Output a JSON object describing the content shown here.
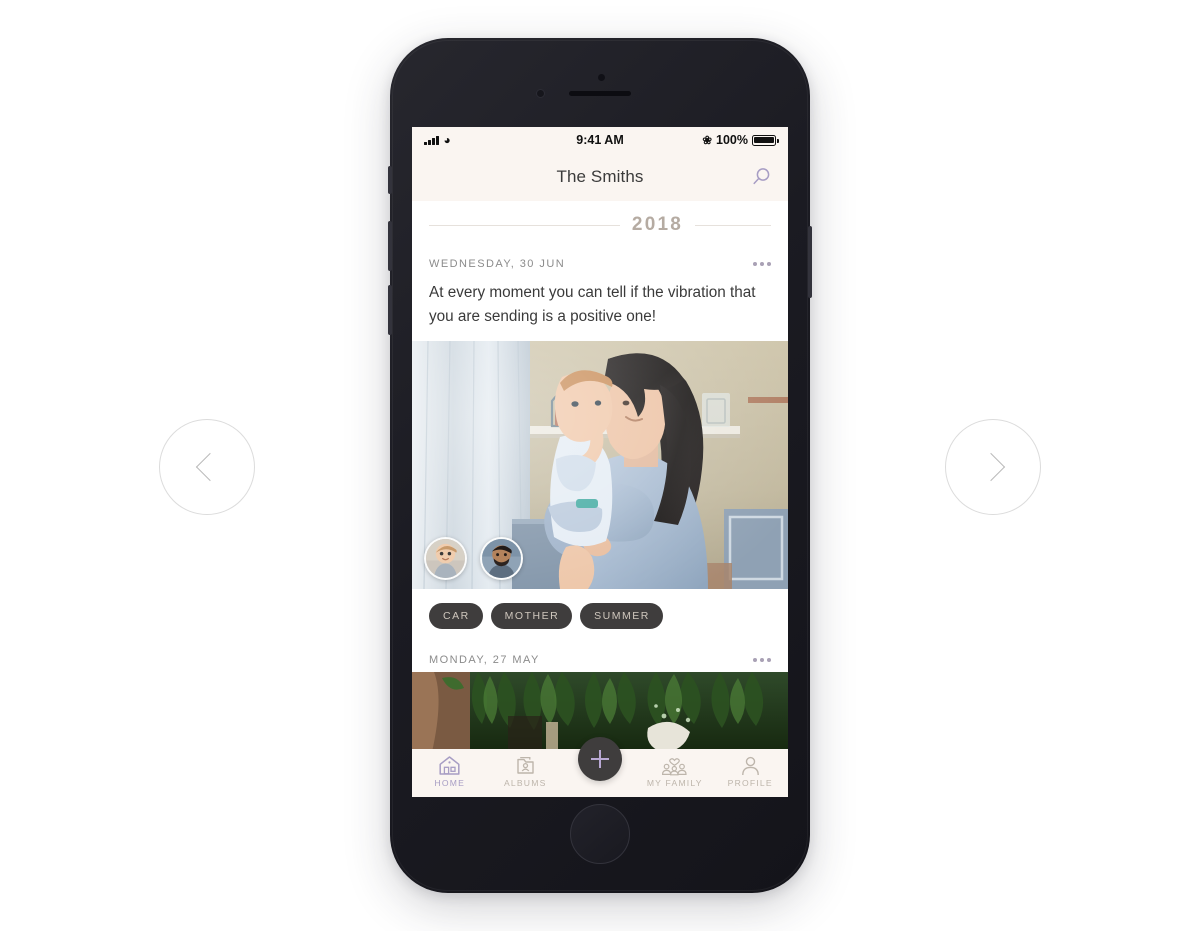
{
  "carousel": {
    "prev_label": "Previous",
    "next_label": "Next"
  },
  "phone": {
    "status_bar": {
      "time": "9:41 AM",
      "battery_percent": "100%",
      "signal_icon": "cellular-bars-icon",
      "wifi_icon": "wifi-icon",
      "bluetooth_icon": "bluetooth-icon",
      "battery_icon": "battery-full-icon"
    },
    "nav": {
      "title": "The Smiths",
      "search_icon": "search-icon"
    },
    "timeline": {
      "year": "2018",
      "posts": [
        {
          "date": "WEDNESDAY, 30 JUN",
          "menu_icon": "more-options-icon",
          "text": "At every moment you can tell if the vibration that you are sending is a positive one!",
          "photo_alt": "mother-holding-baby-photo",
          "avatars": [
            "baby-avatar",
            "father-avatar"
          ],
          "tags": [
            "CAR",
            "MOTHER",
            "SUMMER"
          ]
        },
        {
          "date": "MONDAY, 27 MAY",
          "menu_icon": "more-options-icon",
          "photo_alt": "green-plants-photo"
        }
      ]
    },
    "tab_bar": {
      "items": [
        {
          "label": "HOME",
          "icon": "home-icon",
          "active": true
        },
        {
          "label": "ALBUMS",
          "icon": "albums-icon",
          "active": false
        },
        {
          "label": "MY FAMILY",
          "icon": "family-icon",
          "active": false
        },
        {
          "label": "PROFILE",
          "icon": "profile-icon",
          "active": false
        }
      ],
      "add_button": {
        "label": "+",
        "icon": "plus-icon"
      }
    }
  },
  "colors": {
    "accent_purple": "#a79dc4",
    "cream_bg": "#faf5f1",
    "tag_bg": "#3f3d3d",
    "tag_text": "#cfc7bd",
    "year_text": "#b5aba2",
    "muted_text": "#bdb5ab"
  }
}
